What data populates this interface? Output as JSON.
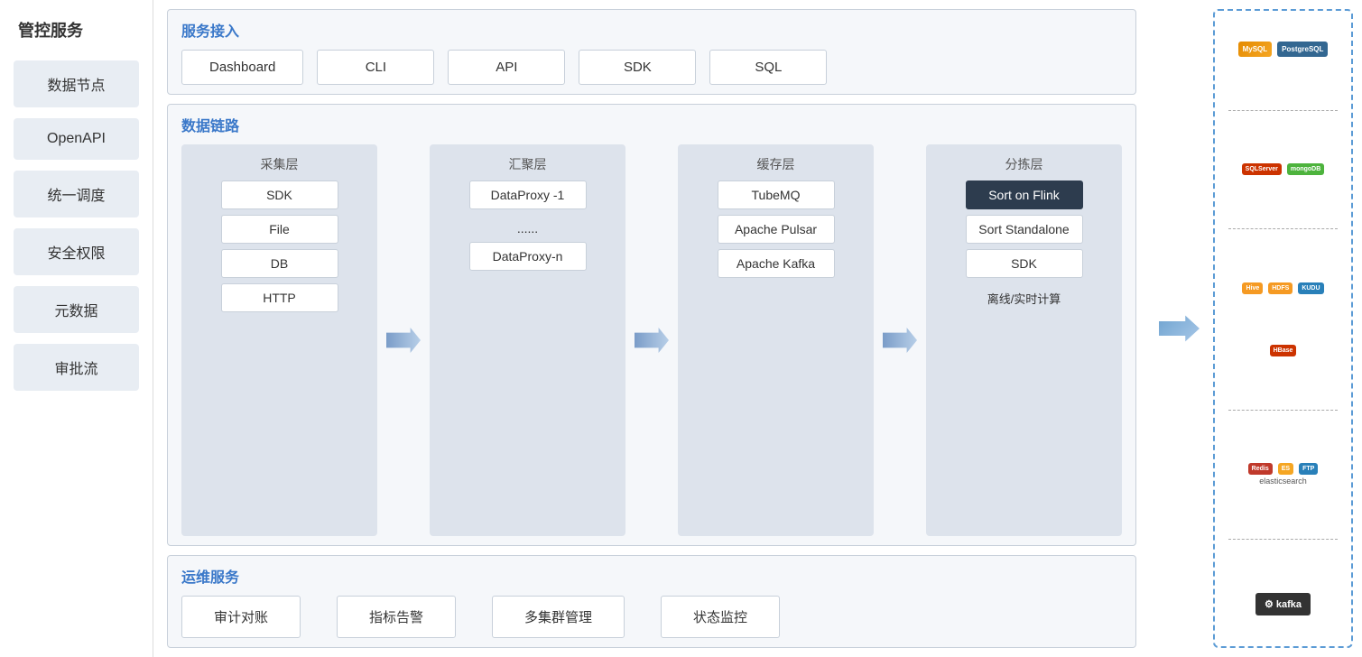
{
  "sidebar": {
    "title": "管控服务",
    "items": [
      {
        "id": "data-node",
        "label": "数据节点"
      },
      {
        "id": "openapi",
        "label": "OpenAPI"
      },
      {
        "id": "unified-schedule",
        "label": "统一调度"
      },
      {
        "id": "security",
        "label": "安全权限"
      },
      {
        "id": "metadata",
        "label": "元数据"
      },
      {
        "id": "approval",
        "label": "审批流"
      }
    ]
  },
  "service_input": {
    "title": "服务接入",
    "items": [
      "Dashboard",
      "CLI",
      "API",
      "SDK",
      "SQL"
    ]
  },
  "data_chain": {
    "title": "数据链路",
    "layers": [
      {
        "id": "collect",
        "title": "采集层",
        "items": [
          "SDK",
          "File",
          "DB",
          "HTTP"
        ]
      },
      {
        "id": "aggregate",
        "title": "汇聚层",
        "items": [
          "DataProxy -1",
          "......",
          "DataProxy-n"
        ]
      },
      {
        "id": "cache",
        "title": "缓存层",
        "items": [
          "TubeMQ",
          "Apache Pulsar",
          "Apache Kafka"
        ]
      },
      {
        "id": "sort",
        "title": "分拣层",
        "items": [
          "Sort on Flink",
          "Sort Standalone",
          "SDK",
          "离线/实时计算"
        ],
        "highlighted": [
          "Sort on Flink"
        ]
      }
    ]
  },
  "ops": {
    "title": "运维服务",
    "items": [
      "审计对账",
      "指标告警",
      "多集群管理",
      "状态监控"
    ]
  },
  "tech_logos": {
    "groups": [
      {
        "items": [
          {
            "label": "MySQL",
            "type": "mysql"
          },
          {
            "label": "PostgreSQL",
            "type": "pg"
          }
        ]
      },
      {
        "items": [
          {
            "label": "SQLServer",
            "type": "sqlserver"
          },
          {
            "label": "mongoDB",
            "type": "mongodb"
          }
        ]
      },
      {
        "items": [
          {
            "label": "Hive",
            "type": "hive"
          },
          {
            "label": "HDFS",
            "type": "hdfs"
          },
          {
            "label": "KUDU",
            "type": "kudu"
          }
        ]
      },
      {
        "items": [
          {
            "label": "HBase",
            "type": "hbase"
          }
        ]
      },
      {
        "items": [
          {
            "label": "Redis",
            "type": "redis"
          },
          {
            "label": "ES",
            "type": "es"
          },
          {
            "label": "FTP",
            "type": "ftp"
          }
        ]
      },
      {
        "items": [
          {
            "label": "Kafka",
            "type": "kafka"
          }
        ]
      }
    ]
  }
}
